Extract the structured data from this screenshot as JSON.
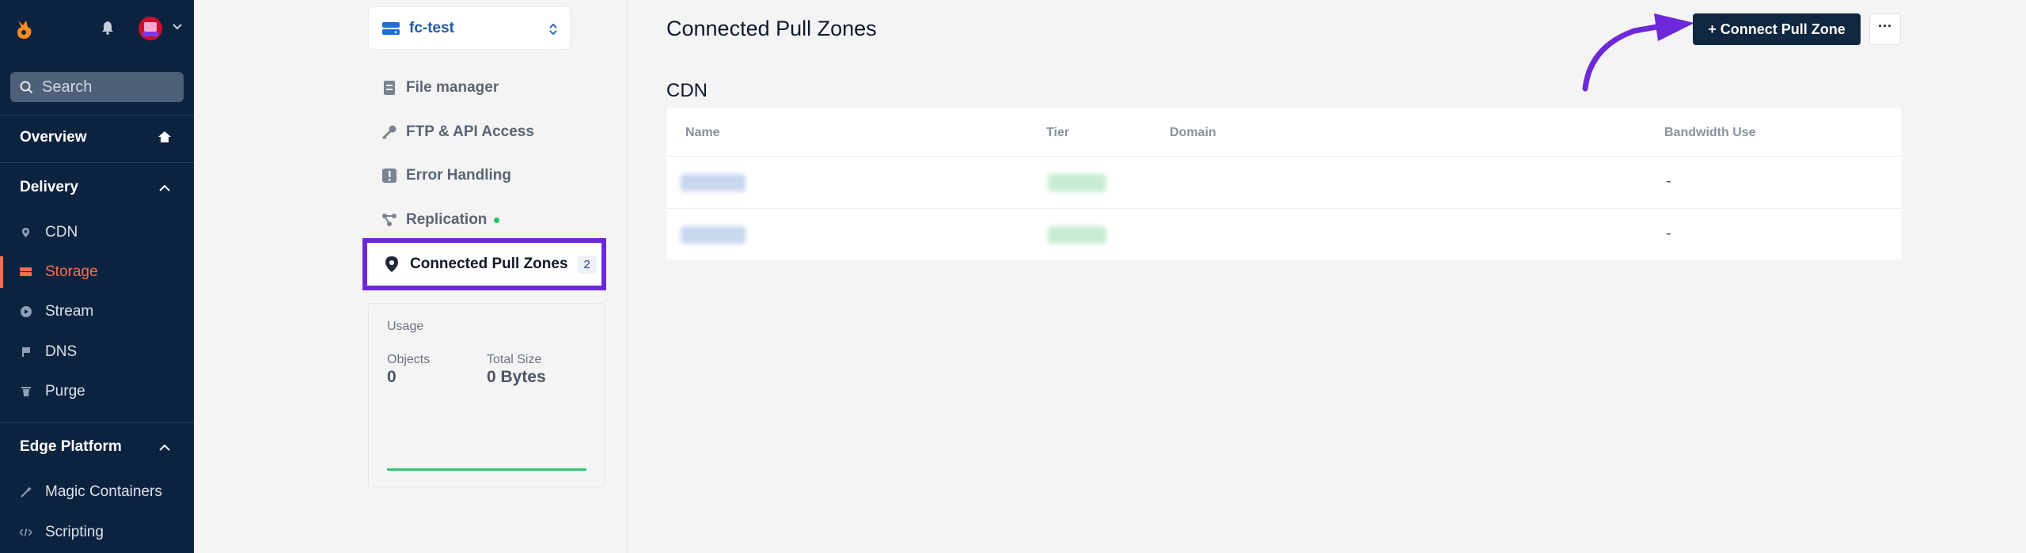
{
  "sidebar": {
    "search_placeholder": "Search",
    "overview": "Overview",
    "delivery": {
      "heading": "Delivery",
      "items": [
        {
          "label": "CDN",
          "icon": "pin-icon"
        },
        {
          "label": "Storage",
          "icon": "storage-icon",
          "active": true
        },
        {
          "label": "Stream",
          "icon": "play-icon"
        },
        {
          "label": "DNS",
          "icon": "flag-icon"
        },
        {
          "label": "Purge",
          "icon": "trash-icon"
        }
      ]
    },
    "edge": {
      "heading": "Edge Platform",
      "items": [
        {
          "label": "Magic Containers",
          "icon": "wand-icon"
        },
        {
          "label": "Scripting",
          "icon": "code-icon"
        }
      ]
    }
  },
  "storage_nav": {
    "zone_name": "fc-test",
    "items": [
      {
        "label": "File manager",
        "icon": "file-icon"
      },
      {
        "label": "FTP & API Access",
        "icon": "key-icon"
      },
      {
        "label": "Error Handling",
        "icon": "alert-icon"
      },
      {
        "label": "Replication",
        "icon": "replication-icon"
      }
    ],
    "active": {
      "label": "Connected Pull Zones",
      "count": "2"
    },
    "usage": {
      "title": "Usage",
      "objects_label": "Objects",
      "objects_value": "0",
      "size_label": "Total Size",
      "size_value": "0 Bytes"
    }
  },
  "main": {
    "title": "Connected Pull Zones",
    "connect_button": "+ Connect Pull Zone",
    "more_button": "···",
    "cdn_section": "CDN",
    "table": {
      "headers": [
        "Name",
        "Tier",
        "Domain",
        "Bandwidth Use"
      ],
      "rows": [
        {
          "bandwidth": "-"
        },
        {
          "bandwidth": "-"
        }
      ]
    }
  },
  "colors": {
    "sidebar_bg": "#0c2340",
    "accent": "#ff6f4d",
    "highlight": "#6d28d9",
    "button_bg": "#0f2740"
  }
}
